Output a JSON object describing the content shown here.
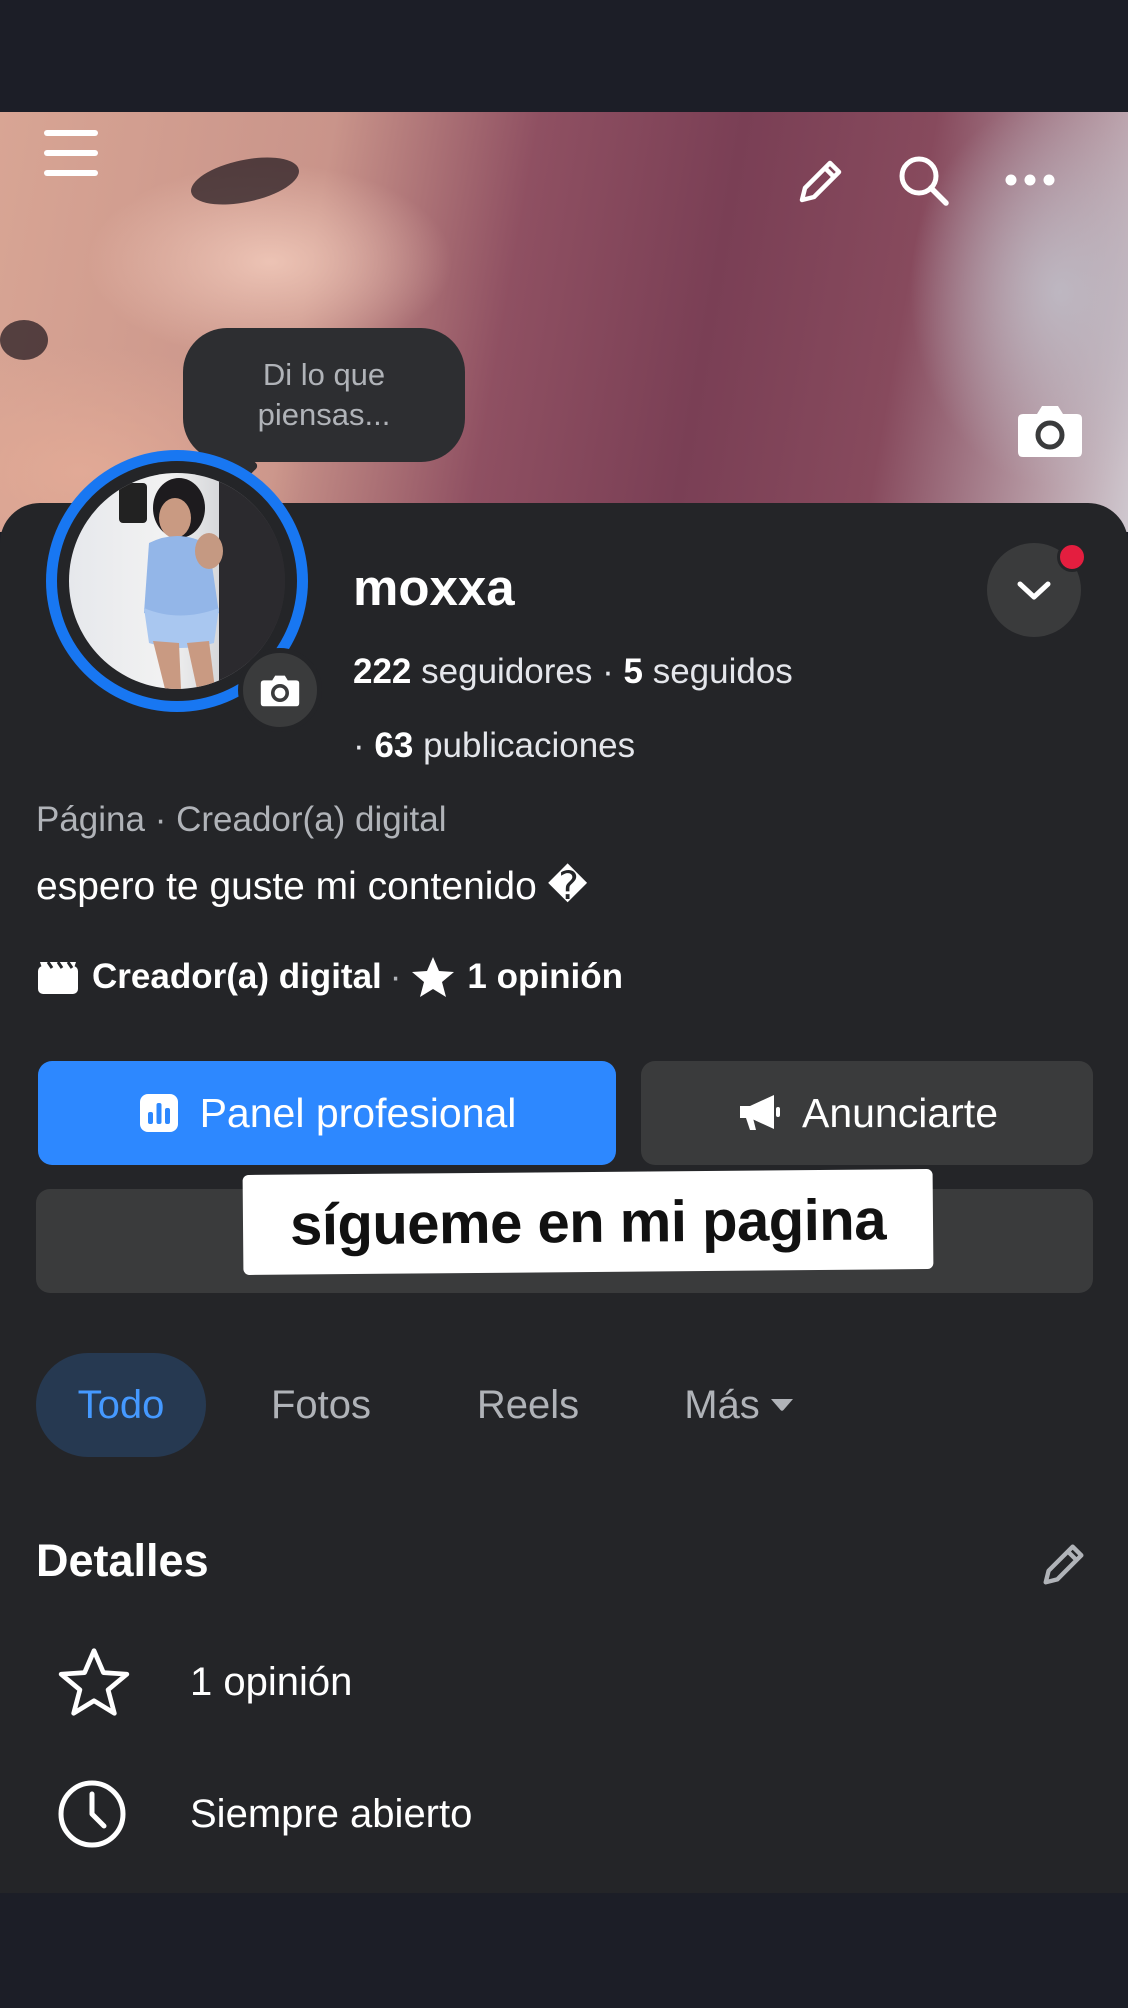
{
  "header": {
    "menu_icon": "hamburger-menu-icon",
    "edit_icon": "pencil-icon",
    "search_icon": "search-icon",
    "more_icon": "more-dots-icon",
    "cover_camera_icon": "camera-icon"
  },
  "status_bubble": {
    "line1": "Di lo que",
    "line2": "piensas..."
  },
  "profile": {
    "name": "moxxa",
    "followers_count": "222",
    "followers_label": "seguidores",
    "following_count": "5",
    "following_label": "seguidos",
    "posts_count": "63",
    "posts_label": "publicaciones",
    "category_line": "Página · Creador(a) digital",
    "bio": "espero te guste mi contenido �",
    "meta_category": "Creador(a) digital",
    "meta_reviews": "1 opinión"
  },
  "actions": {
    "primary_label": "Panel profesional",
    "secondary_label": "Anunciarte",
    "overlay_caption": "sígueme en mi pagina"
  },
  "tabs": [
    {
      "label": "Todo",
      "active": true
    },
    {
      "label": "Fotos",
      "active": false
    },
    {
      "label": "Reels",
      "active": false
    },
    {
      "label": "Más",
      "active": false
    }
  ],
  "details": {
    "title": "Detalles",
    "items": [
      {
        "icon": "star-outline-icon",
        "label": "1 opinión"
      },
      {
        "icon": "clock-icon",
        "label": "Siempre abierto"
      }
    ]
  },
  "colors": {
    "accent": "#2d88ff",
    "ring": "#1877f2",
    "notification": "#e41e3f",
    "surface": "#242528",
    "tab_active_bg": "#263951",
    "tab_active_text": "#4599ff"
  }
}
